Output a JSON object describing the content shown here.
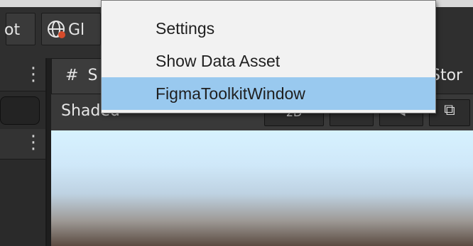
{
  "toolbar": {
    "left_button_label": "ot",
    "global_label": "Gl"
  },
  "scene": {
    "tab_label": "S",
    "tab_hash": "#",
    "shading_mode": "Shaded",
    "store_tab_label": "Stor",
    "button_2d_label": "2D"
  },
  "dropdown": {
    "items": [
      {
        "label": "Settings"
      },
      {
        "label": "Show Data Asset"
      },
      {
        "label": "FigmaToolkitWindow",
        "highlighted": true
      }
    ]
  },
  "icons": {
    "globe": "globe-icon",
    "kebab": "kebab-menu-icon",
    "scene": "hash-icon"
  },
  "colors": {
    "highlight": "#99c9ef",
    "menu_bg": "#f2f2f2",
    "dark_panel": "#2f2f2f"
  }
}
